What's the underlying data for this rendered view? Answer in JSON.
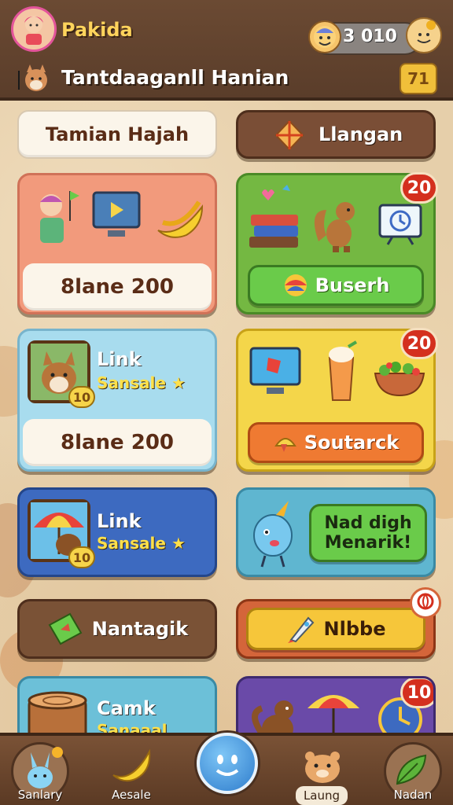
{
  "header": {
    "player_name": "Pakida",
    "subtitle": "Tantdaaganll Hanian",
    "coins": "3 010",
    "level": "71"
  },
  "tabs": {
    "left": "Tamian Hajah",
    "right": "Llangan"
  },
  "cards": [
    {
      "id": "c1",
      "label": "8lane 200"
    },
    {
      "id": "c2",
      "badge": "20",
      "button": "Buserh"
    },
    {
      "id": "c3",
      "title": "Link",
      "subtitle": "Sansale",
      "star": "★",
      "label": "8lane 200",
      "frame_badge": "10"
    },
    {
      "id": "c4",
      "badge": "20",
      "button": "Soutarck"
    },
    {
      "id": "c5",
      "title": "Link",
      "subtitle": "Sansale",
      "star": "★",
      "frame_badge": "10"
    },
    {
      "id": "c6",
      "line1": "Nad digh",
      "line2": "Menarik!"
    },
    {
      "id": "c7",
      "button": "Nantagik"
    },
    {
      "id": "c8",
      "button": "Nlbbe"
    },
    {
      "id": "c9",
      "title": "Camk",
      "subtitle": "Sanaaal"
    },
    {
      "id": "c10",
      "badge": "10"
    }
  ],
  "nav": [
    {
      "label": "Sanlary"
    },
    {
      "label": "Aesale"
    },
    {
      "label": ""
    },
    {
      "label": "Laung"
    },
    {
      "label": "Nadan"
    }
  ],
  "colors": {
    "header": "#5a3d2a",
    "salmon": "#f29a7c",
    "green": "#74b842",
    "light_blue": "#a8dcee",
    "yellow": "#f4d64a",
    "blue": "#3d6ac0",
    "teal": "#5fb6d0",
    "brown": "#7a5236",
    "orange": "#ef7a32",
    "purple": "#6a4aa8"
  },
  "icons": [
    "coin-icon",
    "smile-icon",
    "fox-icon",
    "tv-icon",
    "banana-icon",
    "books-icon",
    "squirrel-icon",
    "clock-icon",
    "ball-icon",
    "drink-icon",
    "salad-icon",
    "kite-icon",
    "rocket-icon",
    "umbrella-icon",
    "log-icon"
  ]
}
